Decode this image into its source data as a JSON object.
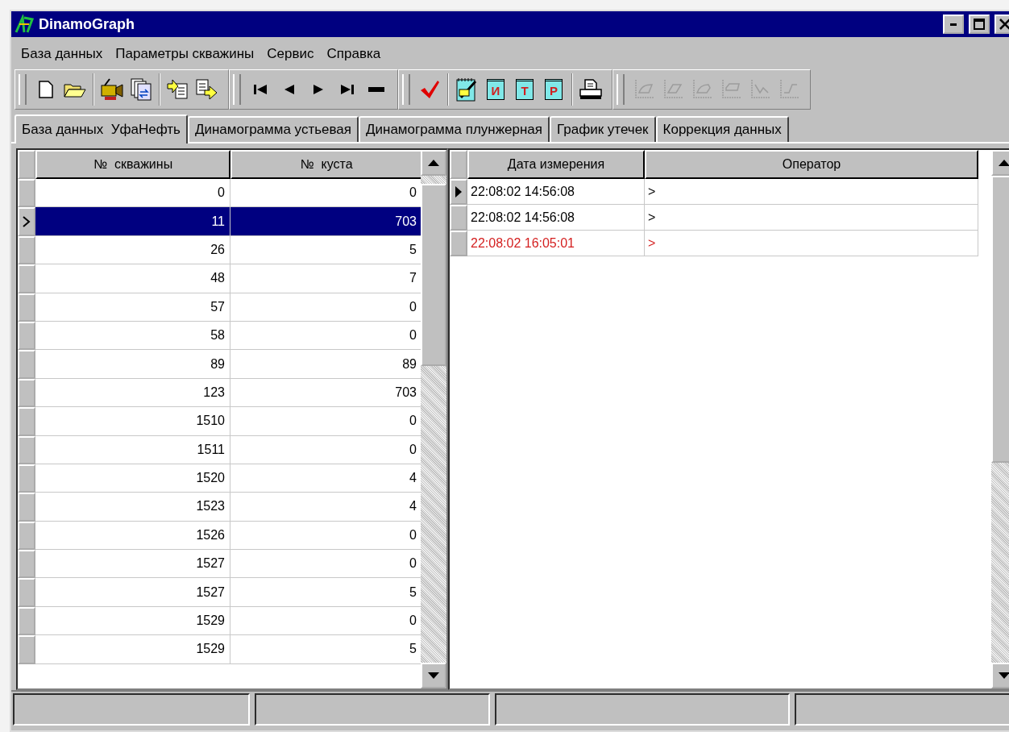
{
  "window": {
    "title": "DinamoGraph"
  },
  "menu": [
    "База данных",
    "Параметры скважины",
    "Сервис",
    "Справка"
  ],
  "toolbar": [
    [
      {
        "kind": "new"
      },
      {
        "kind": "open"
      }
    ],
    [
      {
        "kind": "camera"
      },
      {
        "kind": "copy"
      }
    ],
    [
      {
        "kind": "import"
      },
      {
        "kind": "export"
      }
    ],
    [
      {
        "kind": "first"
      },
      {
        "kind": "prev"
      },
      {
        "kind": "next"
      },
      {
        "kind": "last"
      },
      {
        "kind": "delete"
      }
    ],
    [
      {
        "kind": "check"
      }
    ],
    [
      {
        "kind": "notepad"
      },
      {
        "kind": "letter",
        "label": "И"
      },
      {
        "kind": "letter",
        "label": "Т"
      },
      {
        "kind": "letter",
        "label": "Р"
      }
    ],
    [
      {
        "kind": "print"
      }
    ],
    [
      {
        "kind": "chart1",
        "disabled": true
      },
      {
        "kind": "chart2",
        "disabled": true
      },
      {
        "kind": "chart3",
        "disabled": true
      },
      {
        "kind": "chart4",
        "disabled": true
      },
      {
        "kind": "chart5",
        "disabled": true
      },
      {
        "kind": "chart6",
        "disabled": true
      }
    ]
  ],
  "tabs": [
    {
      "label": "База данных  УфаНефть",
      "selected": true
    },
    {
      "label": "Динамограмма устьевая",
      "selected": false
    },
    {
      "label": "Динамограмма плунжерная",
      "selected": false
    },
    {
      "label": "График утечек",
      "selected": false
    },
    {
      "label": "Коррекция данных",
      "selected": false
    }
  ],
  "wells": {
    "columns": [
      "№  скважины",
      "№  куста"
    ],
    "rows": [
      {
        "cells": [
          "0",
          "0"
        ],
        "selected": false
      },
      {
        "cells": [
          "11",
          "703"
        ],
        "selected": true
      },
      {
        "cells": [
          "26",
          "5"
        ],
        "selected": false
      },
      {
        "cells": [
          "48",
          "7"
        ],
        "selected": false
      },
      {
        "cells": [
          "57",
          "0"
        ],
        "selected": false
      },
      {
        "cells": [
          "58",
          "0"
        ],
        "selected": false
      },
      {
        "cells": [
          "89",
          "89"
        ],
        "selected": false
      },
      {
        "cells": [
          "123",
          "703"
        ],
        "selected": false
      },
      {
        "cells": [
          "1510",
          "0"
        ],
        "selected": false
      },
      {
        "cells": [
          "1511",
          "0"
        ],
        "selected": false
      },
      {
        "cells": [
          "1520",
          "4"
        ],
        "selected": false
      },
      {
        "cells": [
          "1523",
          "4"
        ],
        "selected": false
      },
      {
        "cells": [
          "1526",
          "0"
        ],
        "selected": false
      },
      {
        "cells": [
          "1527",
          "0"
        ],
        "selected": false
      },
      {
        "cells": [
          "1527",
          "5"
        ],
        "selected": false
      },
      {
        "cells": [
          "1529",
          "0"
        ],
        "selected": false
      },
      {
        "cells": [
          "1529",
          "5"
        ],
        "selected": false
      }
    ]
  },
  "measurements": {
    "columns": [
      "Дата измерения",
      "Оператор"
    ],
    "rows": [
      {
        "cells": [
          "22:08:02 14:56:08",
          ">"
        ],
        "current": true,
        "color": "#000000"
      },
      {
        "cells": [
          "22:08:02 14:56:08",
          ">"
        ],
        "current": false,
        "color": "#000000"
      },
      {
        "cells": [
          "22:08:02 16:05:01",
          ">"
        ],
        "current": false,
        "color": "#d42020"
      }
    ]
  }
}
